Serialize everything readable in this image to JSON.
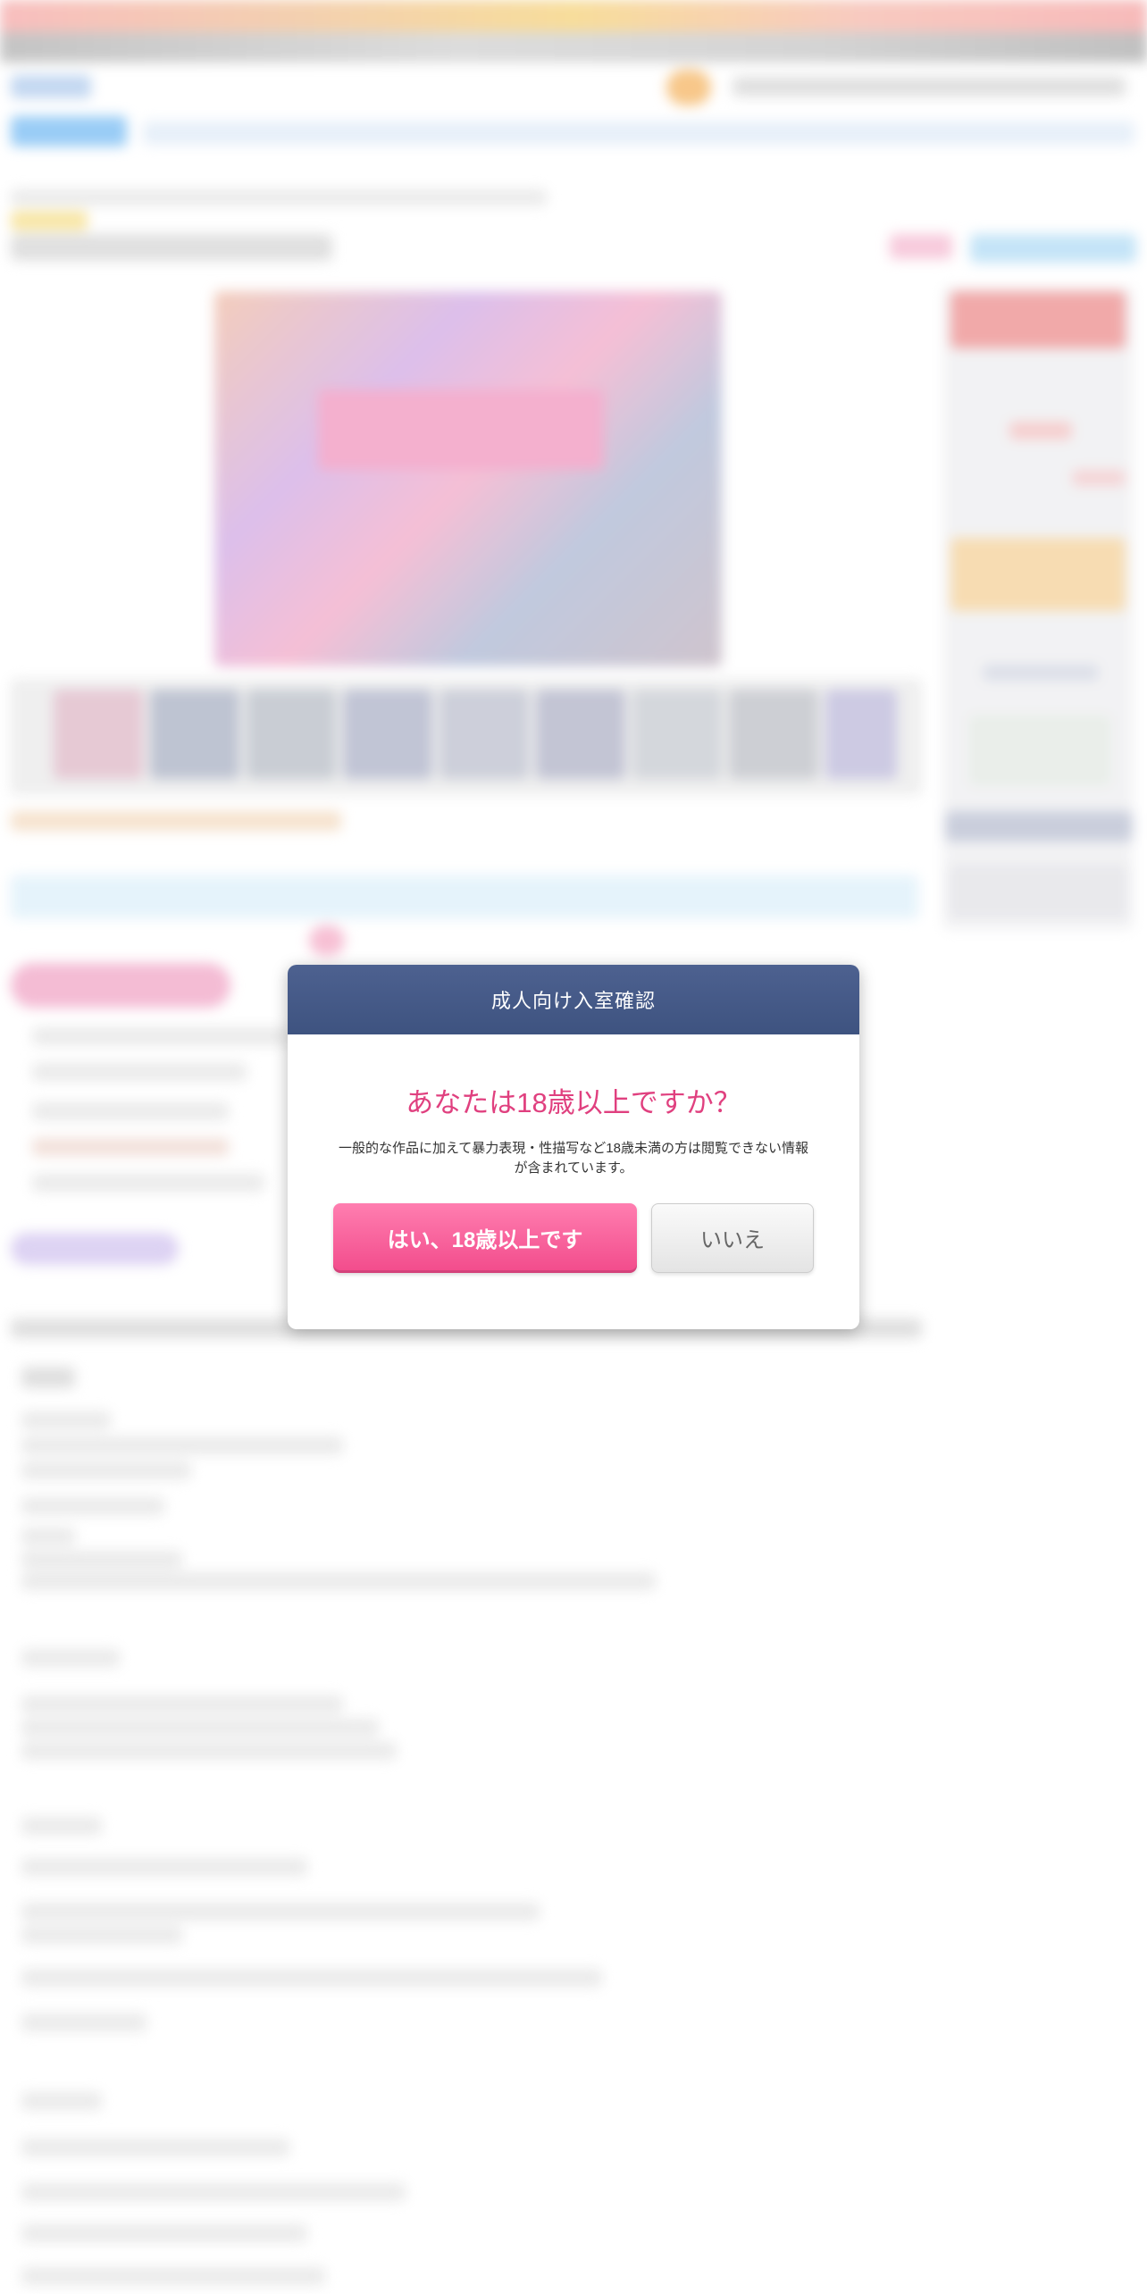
{
  "age_gate": {
    "title": "成人向け入室確認",
    "question": "あなたは18歳以上ですか？",
    "description": "一般的な作品に加えて暴力表現・性描写など18歳未満の方は閲覧できない情報が含まれています。",
    "yes_label": "はい、18歳以上です",
    "no_label": "いいえ"
  },
  "colors": {
    "header_bg": "#43578a",
    "question_text": "#e0407f",
    "yes_button": "#f24b8b",
    "no_button": "#e8e8e8"
  }
}
